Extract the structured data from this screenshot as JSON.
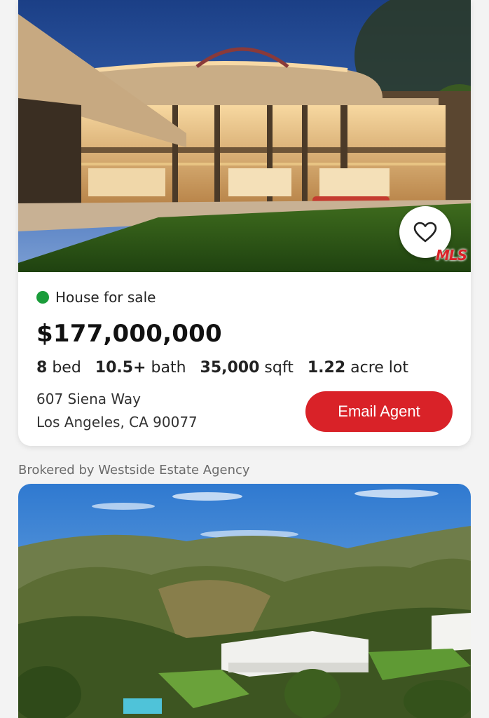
{
  "listing": {
    "status": "House for sale",
    "status_color": "#1a9c3a",
    "price": "$177,000,000",
    "beds_value": "8",
    "beds_label": "bed",
    "baths_value": "10.5+",
    "baths_label": "bath",
    "sqft_value": "35,000",
    "sqft_label": "sqft",
    "lot_value": "1.22",
    "lot_label": "acre lot",
    "address_line1": "607 Siena Way",
    "address_line2": "Los Angeles, CA 90077",
    "email_button": "Email Agent",
    "mls_badge": "MLS",
    "favorite_icon": "heart-outline-icon",
    "broker": "Brokered by Westside Estate Agency"
  },
  "colors": {
    "accent": "#d92228",
    "background": "#f3f3f3"
  }
}
